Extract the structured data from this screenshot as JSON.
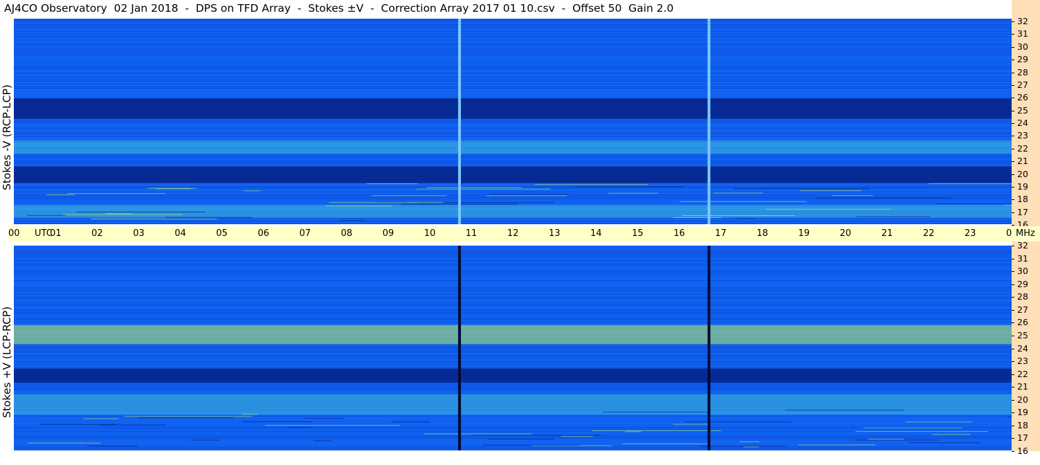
{
  "chart_data": {
    "type": "heatmap",
    "title": "AJ4CO Observatory  02 Jan 2018  -  DPS on TFD Array  -  Stokes ±V  -  Correction Array 2017 01 10.csv  -  Offset 50  Gain 2.0",
    "x_ticks": [
      "00",
      "01",
      "02",
      "03",
      "04",
      "05",
      "06",
      "07",
      "08",
      "09",
      "10",
      "11",
      "12",
      "13",
      "14",
      "15",
      "16",
      "17",
      "18",
      "19",
      "20",
      "21",
      "22",
      "23",
      "00"
    ],
    "x_unit": "UTC",
    "xlim": [
      0,
      24
    ],
    "y_unit": "MHz",
    "ylim": [
      16,
      32
    ],
    "y_ticks": [
      32,
      31,
      30,
      29,
      28,
      27,
      26,
      25,
      24,
      23,
      22,
      21,
      20,
      19,
      18,
      17,
      16
    ],
    "panels": [
      {
        "name": "Stokes -V (RCP-LCP)",
        "bright_bands_mhz": [
          [
            21.5,
            22.5
          ],
          [
            16.5,
            17.5
          ]
        ],
        "dark_bands_mhz": [
          [
            24.2,
            25.8
          ],
          [
            19.2,
            20.5
          ]
        ],
        "burst_hours": [
          10.72,
          16.72
        ],
        "burst_color": "#7cc8ff"
      },
      {
        "name": "Stokes +V (LCP-RCP)",
        "bright_bands_mhz": [
          [
            24.3,
            25.8
          ],
          [
            18.8,
            20.4
          ]
        ],
        "dark_bands_mhz": [
          [
            21.3,
            22.4
          ]
        ],
        "burst_hours": [
          10.72,
          16.72
        ],
        "burst_color": "#000a30"
      }
    ],
    "colors": {
      "deep": "#051a78",
      "mid": "#0f5ef0",
      "light": "#1e9bf0",
      "bright": "#4cd4d8",
      "hot": "#b8f06c"
    }
  }
}
